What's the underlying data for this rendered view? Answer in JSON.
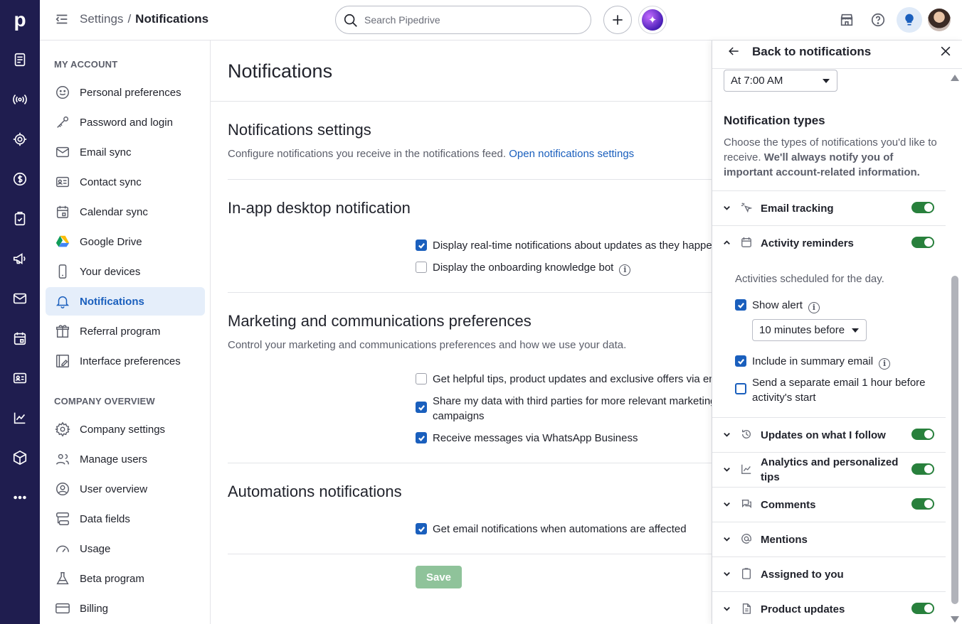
{
  "app": {
    "logo": "p"
  },
  "rail": {
    "icons": [
      "leads-icon",
      "broadcast-icon",
      "target-icon",
      "dollar-icon",
      "clipboard-check-icon",
      "megaphone-icon",
      "mail-icon",
      "calendar-icon",
      "contact-card-icon",
      "chart-icon",
      "box-icon",
      "more-icon"
    ]
  },
  "topbar": {
    "breadcrumb_parent": "Settings",
    "breadcrumb_separator": "/",
    "breadcrumb_current": "Notifications",
    "search_placeholder": "Search Pipedrive"
  },
  "sidebar": {
    "my_account_label": "MY ACCOUNT",
    "company_label": "COMPANY OVERVIEW",
    "my_account": [
      {
        "label": "Personal preferences",
        "icon": "smiley-icon"
      },
      {
        "label": "Password and login",
        "icon": "key-icon"
      },
      {
        "label": "Email sync",
        "icon": "mail-icon"
      },
      {
        "label": "Contact sync",
        "icon": "contact-card-icon"
      },
      {
        "label": "Calendar sync",
        "icon": "calendar-icon"
      },
      {
        "label": "Google Drive",
        "icon": "google-drive-icon"
      },
      {
        "label": "Your devices",
        "icon": "phone-icon"
      },
      {
        "label": "Notifications",
        "icon": "bell-icon",
        "active": true
      },
      {
        "label": "Referral program",
        "icon": "gift-icon"
      },
      {
        "label": "Interface preferences",
        "icon": "interface-icon"
      }
    ],
    "company": [
      {
        "label": "Company settings",
        "icon": "gear-icon"
      },
      {
        "label": "Manage users",
        "icon": "users-icon"
      },
      {
        "label": "User overview",
        "icon": "user-circle-icon"
      },
      {
        "label": "Data fields",
        "icon": "data-fields-icon"
      },
      {
        "label": "Usage",
        "icon": "gauge-icon"
      },
      {
        "label": "Beta program",
        "icon": "flask-icon"
      },
      {
        "label": "Billing",
        "icon": "credit-card-icon"
      }
    ]
  },
  "main": {
    "title": "Notifications",
    "notif_settings": {
      "title": "Notifications settings",
      "desc": "Configure notifications you receive in the notifications feed.",
      "link": "Open notifications settings"
    },
    "inapp": {
      "title": "In-app desktop notification",
      "options": [
        {
          "label": "Display real-time notifications about updates as they happen",
          "checked": true
        },
        {
          "label": "Display the onboarding knowledge bot",
          "checked": false
        }
      ]
    },
    "marketing": {
      "title": "Marketing and communications preferences",
      "desc": "Control your marketing and communications preferences and how we use your data.",
      "options": [
        {
          "label": "Get helpful tips, product updates and exclusive offers via email",
          "checked": false
        },
        {
          "label": "Share my data with third parties for more relevant marketing",
          "label2": "campaigns",
          "checked": true
        },
        {
          "label": "Receive messages via WhatsApp Business",
          "checked": true
        }
      ]
    },
    "automations": {
      "title": "Automations notifications",
      "options": [
        {
          "label": "Get email notifications when automations are affected",
          "checked": true
        }
      ]
    },
    "save_label": "Save"
  },
  "panel": {
    "back_label": "Back to notifications",
    "time_select": "At 7:00 AM",
    "types_title": "Notification types",
    "types_desc": "Choose the types of notifications you'd like to receive.",
    "types_desc_bold": "We'll always notify you of important account-related information.",
    "rows": [
      {
        "label": "Email tracking",
        "icon": "cursor-click-icon",
        "toggle": true,
        "expanded": false
      },
      {
        "label": "Activity reminders",
        "icon": "calendar-icon",
        "toggle": true,
        "expanded": true
      },
      {
        "label": "Updates on what I follow",
        "icon": "history-icon",
        "toggle": true,
        "expanded": false
      },
      {
        "label": "Analytics and personalized",
        "label2": "tips",
        "icon": "chart-icon",
        "toggle": true,
        "expanded": false
      },
      {
        "label": "Comments",
        "icon": "comments-icon",
        "toggle": true,
        "expanded": false
      },
      {
        "label": "Mentions",
        "icon": "at-icon",
        "toggle": false,
        "expanded": false
      },
      {
        "label": "Assigned to you",
        "icon": "clipboard-icon",
        "toggle": false,
        "expanded": false
      },
      {
        "label": "Product updates",
        "icon": "document-icon",
        "toggle": true,
        "expanded": false
      }
    ],
    "activity": {
      "desc": "Activities scheduled for the day.",
      "show_alert": "Show alert",
      "alert_select": "10 minutes before",
      "summary_email": "Include in summary email",
      "separate_email": "Send a separate email 1 hour before",
      "separate_email_2": "activity's start"
    }
  },
  "colors": {
    "rail": "#1f1d4f",
    "accent": "#1a5fbd",
    "toggle_on": "#28803c",
    "save_disabled": "#8fc39a"
  }
}
